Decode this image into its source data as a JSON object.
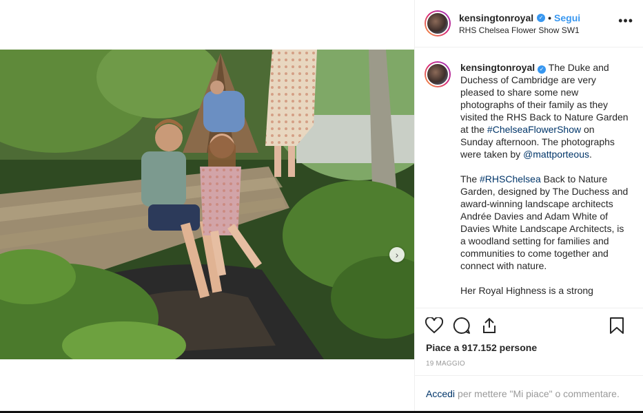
{
  "header": {
    "username": "kensingtonroyal",
    "separator": "•",
    "follow_label": "Segui",
    "location": "RHS Chelsea Flower Show SW1",
    "more_label": "•••"
  },
  "caption": {
    "username": "kensingtonroyal",
    "p1_text1": " The Duke and Duchess of Cambridge are very pleased to share some new photographs of their family as they visited the RHS Back to Nature Garden at the ",
    "p1_tag": "#ChelseaFlowerShow",
    "p1_text2": " on Sunday afternoon. The photographs were taken by ",
    "p1_mention": "@mattporteous",
    "p1_text3": ".",
    "p2_text1": "The ",
    "p2_tag": "#RHSChelsea",
    "p2_text2": " Back to Nature Garden, designed by The Duchess and award-winning landscape architects Andrée Davies and Adam White of Davies White Landscape Architects, is a woodland setting for families and communities to come together and connect with nature.",
    "p3_partial": "Her Royal Highness is a strong"
  },
  "actions": {
    "like_icon": "heart-icon",
    "comment_icon": "comment-icon",
    "share_icon": "share-icon",
    "save_icon": "bookmark-icon"
  },
  "likes_text": "Piace a 917.152 persone",
  "date_text": "19 MAGGIO",
  "login": {
    "link": "Accedi",
    "rest": "per mettere \"Mi piace\" o commentare."
  },
  "colors": {
    "accent": "#3897f0",
    "link": "#003569",
    "muted": "#999999"
  }
}
